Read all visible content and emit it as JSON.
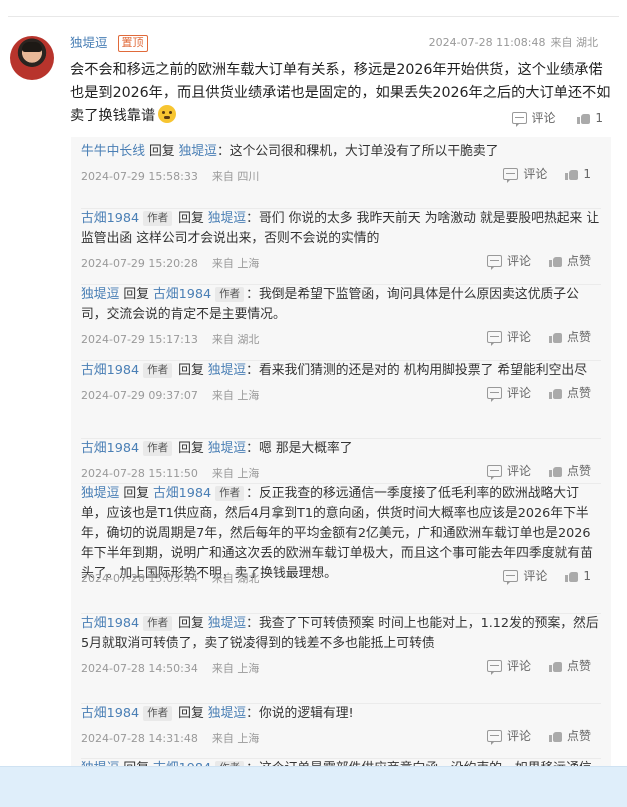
{
  "main_comment": {
    "author": "独堤逗",
    "badge": "置顶",
    "time": "2024-07-28 11:08:48",
    "location": "来自 湖北",
    "text": "会不会和移远之前的欧洲车载大订单有关系，移远是2026年开始供货，这个业绩承偌也是到2026年，而且供货业绩承诺也是固定的，如果丢失2026年之后的大订单还不如卖了换钱靠谱",
    "comment_label": "评论",
    "like_count": "1"
  },
  "replies": [
    {
      "from": "牛牛中长线",
      "from_author": false,
      "reply_word": "回复",
      "to": "独堤逗",
      "to_author": false,
      "text": "这个公司很和稞机，大订单没有了所以干脆卖了",
      "time": "2024-07-29 15:58:33",
      "location": "来自 四川",
      "comment_label": "评论",
      "like_label": "1"
    },
    {
      "from": "古畑1984",
      "from_author": true,
      "author_tag": "作者",
      "reply_word": "回复",
      "to": "独堤逗",
      "to_author": false,
      "text": "哥们 你说的太多 我昨天前天 为啥激动 就是要股吧热起来 让监管出函 这样公司才会说出来，否则不会说的实情的",
      "time": "2024-07-29 15:20:28",
      "location": "来自 上海",
      "comment_label": "评论",
      "like_label": "点赞"
    },
    {
      "from": "独堤逗",
      "from_author": false,
      "reply_word": "回复",
      "to": "古畑1984",
      "to_author": true,
      "author_tag": "作者",
      "text": "我倒是希望下监管函，询问具体是什么原因卖这优质子公司，交流会说的肯定不是主要情况。",
      "time": "2024-07-29 15:17:13",
      "location": "来自 湖北",
      "comment_label": "评论",
      "like_label": "点赞"
    },
    {
      "from": "古畑1984",
      "from_author": true,
      "author_tag": "作者",
      "reply_word": "回复",
      "to": "独堤逗",
      "to_author": false,
      "text": "看来我们猜测的还是对的 机构用脚投票了 希望能利空出尽",
      "time": "2024-07-29 09:37:07",
      "location": "来自 上海",
      "comment_label": "评论",
      "like_label": "点赞"
    },
    {
      "from": "古畑1984",
      "from_author": true,
      "author_tag": "作者",
      "reply_word": "回复",
      "to": "独堤逗",
      "to_author": false,
      "text": "嗯 那是大概率了",
      "time": "2024-07-28 15:11:50",
      "location": "来自 上海",
      "comment_label": "评论",
      "like_label": "点赞"
    },
    {
      "from": "独堤逗",
      "from_author": false,
      "reply_word": "回复",
      "to": "古畑1984",
      "to_author": true,
      "author_tag": "作者",
      "text": "反正我查的移远通信一季度接了低毛利率的欧洲战略大订单，应该也是T1供应商，然后4月拿到T1的意向函，供货时间大概率也应该是2026年下半年，确切的说周期是7年，然后每年的平均金额有2亿美元，广和通欧洲车载订单也是2026年下半年到期，说明广和通这次丢的欧洲车载订单极大，而且这个事可能去年四季度就有苗头了。加上国际形势不明，卖了换钱最理想。",
      "time": "2024-07-28 15:03:44",
      "location": "来自 湖北",
      "comment_label": "评论",
      "like_label": "1"
    },
    {
      "from": "古畑1984",
      "from_author": true,
      "author_tag": "作者",
      "reply_word": "回复",
      "to": "独堤逗",
      "to_author": false,
      "text": "我查了下可转债预案 时间上也能对上，1.12发的预案，然后5月就取消可转债了，卖了锐凌得到的钱差不多也能抵上可转债",
      "time": "2024-07-28 14:50:34",
      "location": "来自 上海",
      "comment_label": "评论",
      "like_label": "点赞"
    },
    {
      "from": "古畑1984",
      "from_author": true,
      "author_tag": "作者",
      "reply_word": "回复",
      "to": "独堤逗",
      "to_author": false,
      "text": "你说的逻辑有理!",
      "time": "2024-07-28 14:31:48",
      "location": "来自 上海",
      "comment_label": "评论",
      "like_label": "点赞"
    },
    {
      "from": "独堤逗",
      "from_author": false,
      "reply_word": "回复",
      "to": "古畑1984",
      "to_author": true,
      "author_tag": "作者",
      "text": "这个订单是零部件供应商意向函，没约束的，如果移远通信禁止",
      "time": "",
      "location": "",
      "comment_label": "",
      "like_label": ""
    }
  ]
}
